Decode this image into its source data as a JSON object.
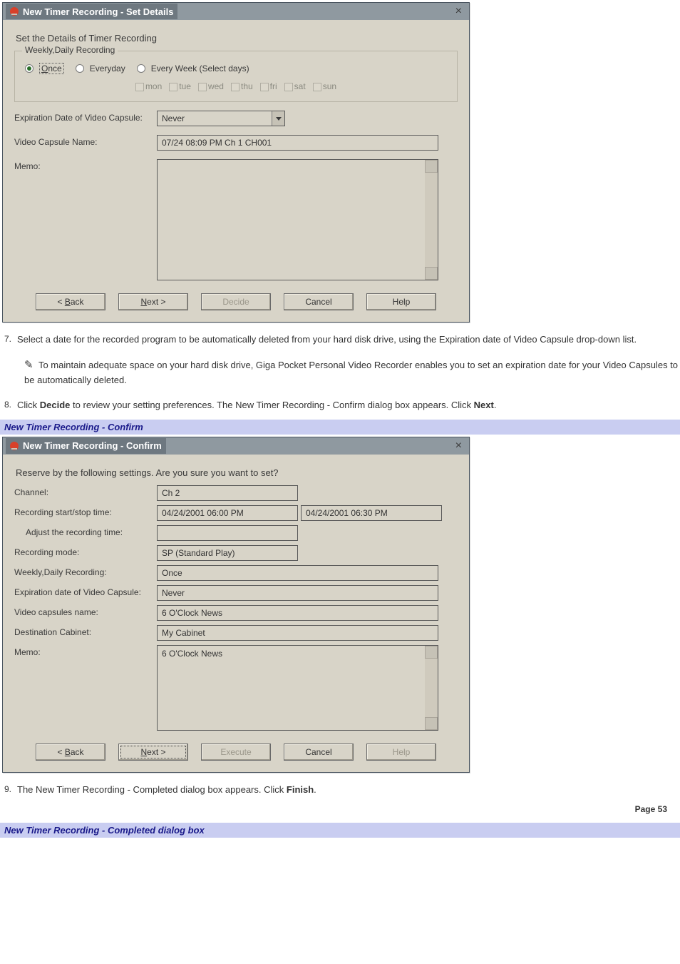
{
  "dialog1": {
    "title": "New Timer Recording - Set Details",
    "instruction": "Set the Details of Timer Recording",
    "fieldset_legend": "Weekly,Daily Recording",
    "radios": {
      "once": "Once",
      "everyday": "Everyday",
      "every_week": "Every Week (Select days)"
    },
    "days": {
      "mon": "mon",
      "tue": "tue",
      "wed": "wed",
      "thu": "thu",
      "fri": "fri",
      "sat": "sat",
      "sun": "sun"
    },
    "exp_label": "Expiration Date of Video Capsule:",
    "exp_value": "Never",
    "name_label": "Video Capsule Name:",
    "name_value": "07/24 08:09 PM Ch 1 CH001",
    "memo_label": "Memo:",
    "buttons": {
      "back": "< Back",
      "next": "Next >",
      "decide": "Decide",
      "cancel": "Cancel",
      "help": "Help"
    }
  },
  "steps": {
    "s7_num": "7.",
    "s7_text": "Select a date for the recorded program to be automatically deleted from your hard disk drive, using the Expiration date of Video Capsule drop-down list.",
    "note_text": "To maintain adequate space on your hard disk drive, Giga Pocket Personal Video Recorder enables you to set an expiration date for your Video Capsules to be automatically deleted.",
    "s8_num": "8.",
    "s8_a": "Click ",
    "s8_b": "Decide",
    "s8_c": " to review your setting preferences. The New Timer Recording - Confirm dialog box appears. Click ",
    "s8_d": "Next",
    "s8_e": ".",
    "s9_num": "9.",
    "s9_a": "The New Timer Recording - Completed dialog box appears. Click ",
    "s9_b": "Finish",
    "s9_c": "."
  },
  "heading1": "New Timer Recording - Confirm",
  "dialog2": {
    "title": "New Timer Recording - Confirm",
    "instruction": "Reserve by the following settings. Are you sure you want to set?",
    "channel_label": "Channel:",
    "channel_value": "Ch 2",
    "startstop_label": "Recording start/stop time:",
    "start_value": "04/24/2001 06:00 PM",
    "stop_value": "04/24/2001 06:30 PM",
    "adjust_label": "Adjust the recording time:",
    "adjust_value": "",
    "mode_label": "Recording mode:",
    "mode_value": "SP (Standard Play)",
    "recurrence_label": "Weekly,Daily Recording:",
    "recurrence_value": "Once",
    "exp_label": "Expiration date of Video Capsule:",
    "exp_value": "Never",
    "capsules_label": "Video capsules name:",
    "capsules_value": "6 O'Clock News",
    "dest_label": "Destination Cabinet:",
    "dest_value": "My Cabinet",
    "memo_label": "Memo:",
    "memo_value": "6 O'Clock News",
    "buttons": {
      "back": "< Back",
      "next": "Next >",
      "execute": "Execute",
      "cancel": "Cancel",
      "help": "Help"
    }
  },
  "heading2": "New Timer Recording - Completed dialog box",
  "page_number": "Page 53"
}
